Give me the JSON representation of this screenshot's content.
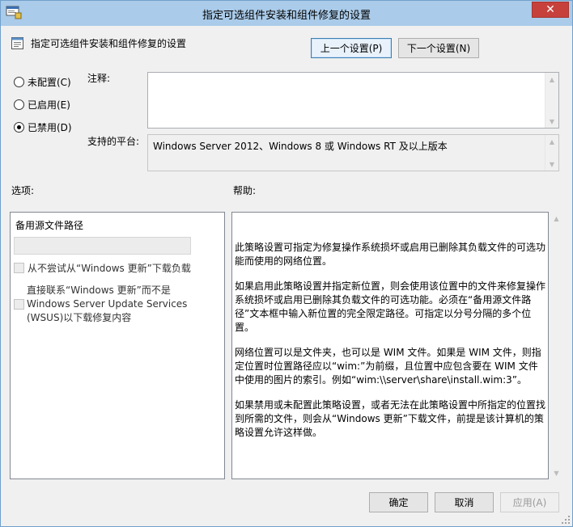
{
  "window": {
    "title": "指定可选组件安装和组件修复的设置",
    "close_label": "✕"
  },
  "header": {
    "policy_name": "指定可选组件安装和组件修复的设置",
    "prev_button": "上一个设置(P)",
    "next_button": "下一个设置(N)"
  },
  "state": {
    "options": [
      {
        "label": "未配置(C)",
        "checked": false
      },
      {
        "label": "已启用(E)",
        "checked": false
      },
      {
        "label": "已禁用(D)",
        "checked": true
      }
    ]
  },
  "comment": {
    "label": "注释:",
    "value": ""
  },
  "platform": {
    "label": "支持的平台:",
    "value": "Windows Server 2012、Windows 8 或 Windows RT 及以上版本"
  },
  "options_section": {
    "label": "选项:",
    "path_label": "备用源文件路径",
    "path_value": "",
    "checkbox1": "从不尝试从“Windows 更新”下载负载",
    "checkbox2": "直接联系“Windows 更新”而不是 Windows Server Update Services (WSUS)以下载修复内容"
  },
  "help_section": {
    "label": "帮助:",
    "paragraphs": [
      "此策略设置可指定为修复操作系统损坏或启用已删除其负载文件的可选功能而使用的网络位置。",
      "如果启用此策略设置并指定新位置，则会使用该位置中的文件来修复操作系统损坏或启用已删除其负载文件的可选功能。必须在“备用源文件路径”文本框中输入新位置的完全限定路径。可指定以分号分隔的多个位置。",
      "网络位置可以是文件夹，也可以是 WIM 文件。如果是 WIM 文件，则指定位置时位置路径应以“wim:”为前缀，且位置中应包含要在 WIM 文件中使用的图片的索引。例如“wim:\\\\server\\share\\install.wim:3”。",
      "如果禁用或未配置此策略设置，或者无法在此策略设置中所指定的位置找到所需的文件，则会从“Windows 更新”下载文件，前提是该计算机的策略设置允许这样做。"
    ]
  },
  "footer": {
    "ok": "确定",
    "cancel": "取消",
    "apply": "应用(A)"
  },
  "colors": {
    "titlebar": "#aacbe9",
    "close": "#c7413c"
  }
}
